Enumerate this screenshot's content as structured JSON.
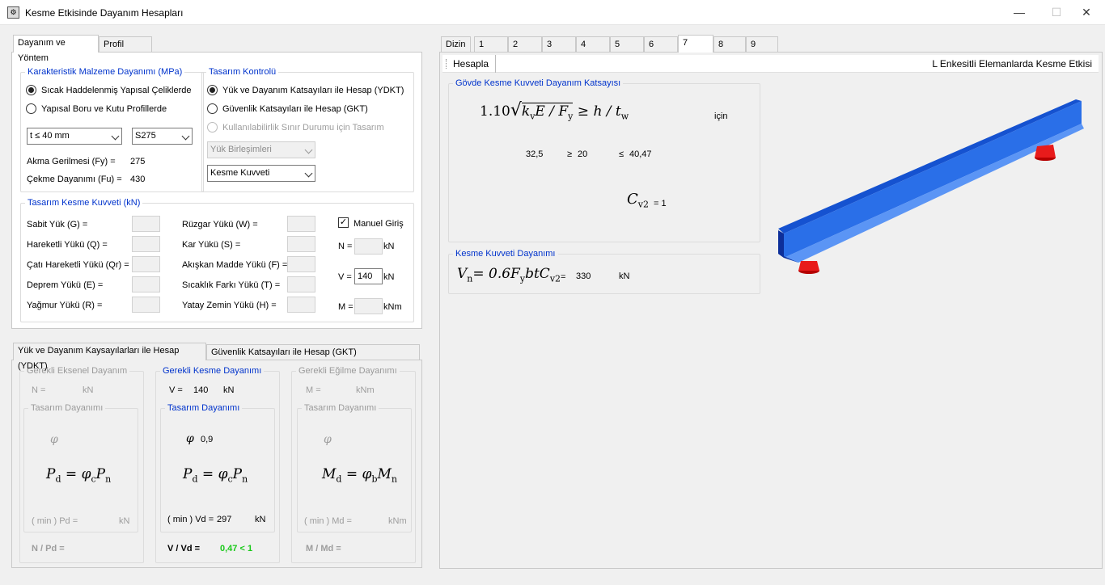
{
  "window": {
    "title": "Kesme Etkisinde Dayanım Hesapları",
    "minimize": "—",
    "maximize": "☐",
    "close": "✕"
  },
  "left_tabs": [
    "Dayanım ve Yöntem",
    "Profil Seçimi"
  ],
  "material": {
    "title": "Karakteristik Malzeme Dayanımı (MPa)",
    "option1": "Sıcak Haddelenmiş Yapısal Çeliklerde",
    "option2": "Yapısal Boru ve Kutu Profillerde",
    "thickness": "t ≤ 40 mm",
    "grade": "S275",
    "fy_label": "Akma Gerilmesi (Fy) =",
    "fy_value": "275",
    "fu_label": "Çekme Dayanımı (Fu) =",
    "fu_value": "430"
  },
  "design": {
    "title": "Tasarım Kontrolü",
    "option1": "Yük ve Dayanım Katsayıları ile Hesap (YDKT)",
    "option2": "Güvenlik Katsayıları ile Hesap (GKT)",
    "option3": "Kullanılabilirlik Sınır Durumu için Tasarım",
    "load_combo": "Yük Birleşimleri",
    "force_type": "Kesme Kuvveti"
  },
  "loads": {
    "title": "Tasarım Kesme Kuvveti (kN)",
    "col1": [
      "Sabit Yük (G) =",
      "Hareketli Yükü (Q) =",
      "Çatı Hareketli Yükü (Qr) =",
      "Deprem Yükü (E) =",
      "Yağmur Yükü (R) ="
    ],
    "col2": [
      "Rüzgar Yükü (W) =",
      "Kar Yükü (S) =",
      "Akışkan Madde Yükü (F) =",
      "Sıcaklık Farkı Yükü (T) =",
      "Yatay Zemin Yükü (H) ="
    ],
    "manual_label": "Manuel Giriş",
    "manual_check": "✓",
    "n_label": "N =",
    "n_unit": "kN",
    "v_label": "V =",
    "v_value": "140",
    "v_unit": "kN",
    "m_label": "M =",
    "m_unit": "kNm"
  },
  "bottom_tabs": [
    "Yük ve Dayanım Kaysayılarları ile Hesap (YDKT)",
    "Güvenlik Katsayıları ile Hesap (GKT)"
  ],
  "axial": {
    "title": "Gerekli Eksenel Dayanım",
    "req_label": "N =",
    "req_unit": "kN",
    "design_title": "Tasarım Dayanımı",
    "phi": "φ",
    "formula_lhs": "P",
    "formula_lhs_sub": "d",
    "formula_phi": "φ",
    "formula_phi_sub": "c",
    "formula_rhs": "P",
    "formula_rhs_sub": "n",
    "min_label": "( min ) Pd =",
    "min_unit": "kN",
    "ratio_label": "N / Pd ="
  },
  "shear": {
    "title": "Gerekli Kesme Dayanımı",
    "req_label": "V =",
    "req_value": "140",
    "req_unit": "kN",
    "design_title": "Tasarım Dayanımı",
    "phi": "φ",
    "phi_value": "0,9",
    "formula_lhs": "P",
    "formula_lhs_sub": "d",
    "formula_phi": "φ",
    "formula_phi_sub": "c",
    "formula_rhs": "P",
    "formula_rhs_sub": "n",
    "min_label": "( min ) Vd =",
    "min_value": "297",
    "min_unit": "kN",
    "ratio_label": "V / Vd =",
    "ratio_value": "0,47 < 1"
  },
  "moment": {
    "title": "Gerekli Eğilme Dayanımı",
    "req_label": "M =",
    "req_unit": "kNm",
    "design_title": "Tasarım Dayanımı",
    "phi": "φ",
    "formula_lhs": "M",
    "formula_lhs_sub": "d",
    "formula_phi": "φ",
    "formula_phi_sub": "b",
    "formula_rhs": "M",
    "formula_rhs_sub": "n",
    "min_label": "( min ) Md =",
    "min_unit": "kNm",
    "ratio_label": "M / Md ="
  },
  "right_tabs": [
    "Dizin",
    "1",
    "2",
    "3",
    "4",
    "5",
    "6",
    "7",
    "8",
    "9"
  ],
  "right_active_tab": "7",
  "toolbar": {
    "calc": "Hesapla",
    "heading": "L Enkesitli Elemanlarda Kesme Etkisi"
  },
  "coef": {
    "title": "Gövde Kesme Kuvveti Dayanım Katsayısı",
    "formula": "1.10",
    "sqrt_k": "k",
    "sqrt_k_sub": "v",
    "sqrt_e": "E / F",
    "sqrt_f_sub": "y",
    "ineq": "≥ h / t",
    "ineq_sub": "w",
    "for_label": "için",
    "val1": "32,5",
    "ge": "≥",
    "val2": "20",
    "le": "≤",
    "val3": "40,47",
    "cv_symbol": "C",
    "cv_sub": "v2",
    "cv_eq": "= 1"
  },
  "shear_res": {
    "title": "Kesme Kuvveti Dayanımı",
    "lhs": "V",
    "lhs_sub": "n",
    "rhs": "= 0.6F",
    "rhs_sub": "y",
    "rhs2": "btC",
    "rhs2_sub": "v2",
    "eq": "=",
    "value": "330",
    "unit": "kN"
  },
  "colors": {
    "accent": "#0033cc",
    "beam": "#2a6fe8",
    "support": "#e81b1b",
    "ok": "#18c918"
  }
}
